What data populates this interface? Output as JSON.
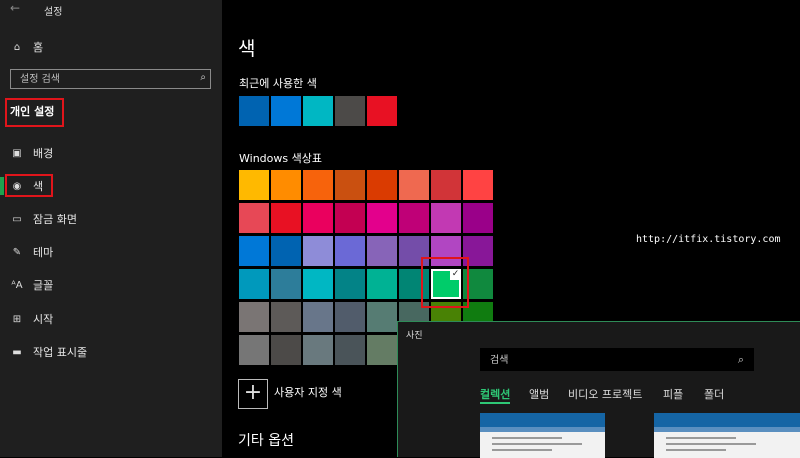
{
  "window": {
    "title": "설정",
    "back_glyph": "←"
  },
  "sidebar": {
    "home": {
      "icon": "home-icon",
      "glyph": "⌂",
      "label": "홈"
    },
    "search_placeholder": "설정 검색",
    "search_icon": "⌕",
    "section_title": "개인 설정",
    "items": [
      {
        "icon": "picture-icon",
        "glyph": "▣",
        "label": "배경"
      },
      {
        "icon": "palette-icon",
        "glyph": "◉",
        "label": "색"
      },
      {
        "icon": "lock-screen-icon",
        "glyph": "▭",
        "label": "잠금 화면"
      },
      {
        "icon": "theme-icon",
        "glyph": "✎",
        "label": "테마"
      },
      {
        "icon": "font-icon",
        "glyph": "ᴬA",
        "label": "글꼴"
      },
      {
        "icon": "start-icon",
        "glyph": "⊞",
        "label": "시작"
      },
      {
        "icon": "taskbar-icon",
        "glyph": "▬",
        "label": "작업 표시줄"
      }
    ],
    "accent_color": "#1ea34f"
  },
  "main": {
    "title": "색",
    "recent_label": "최근에 사용한 색",
    "recent_colors": [
      "#0063b1",
      "#0078d7",
      "#00b7c3",
      "#4c4a48",
      "#e81123"
    ],
    "palette_label": "Windows 색상표",
    "palette_rows": [
      [
        "#ffb900",
        "#ff8c00",
        "#f7630c",
        "#ca5010",
        "#da3b01",
        "#ef6950",
        "#d13438",
        "#ff4343"
      ],
      [
        "#e74856",
        "#e81123",
        "#ea005e",
        "#c30052",
        "#e3008c",
        "#bf0077",
        "#c239b3",
        "#9a0089"
      ],
      [
        "#0078d7",
        "#0063b1",
        "#8e8cd8",
        "#6b69d6",
        "#8764b8",
        "#744da9",
        "#b146c2",
        "#881798"
      ],
      [
        "#0099bc",
        "#2d7d9a",
        "#00b7c3",
        "#038387",
        "#00b294",
        "#018574",
        "#00cc6a",
        "#10893e"
      ],
      [
        "#7a7574",
        "#5d5a58",
        "#68768a",
        "#515c6b",
        "#567c73",
        "#486860",
        "#498205",
        "#107c10"
      ],
      [
        "#767676",
        "#4c4a48",
        "#69797e",
        "#4a5459",
        "#647c64",
        "#525e54",
        "#847545",
        "#7e735f"
      ]
    ],
    "selected_check": "✓",
    "custom_plus": "+",
    "custom_label": "사용자 지정 색",
    "other_options": "기타 옵션"
  },
  "watermark_url": "http://itfix.tistory.com",
  "photos_window": {
    "title": "사진",
    "search_placeholder": "검색",
    "search_icon": "⌕",
    "tabs": [
      "컬렉션",
      "앨범",
      "비디오 프로젝트",
      "피플",
      "폴더"
    ],
    "active_tab_color": "#2ec775"
  }
}
